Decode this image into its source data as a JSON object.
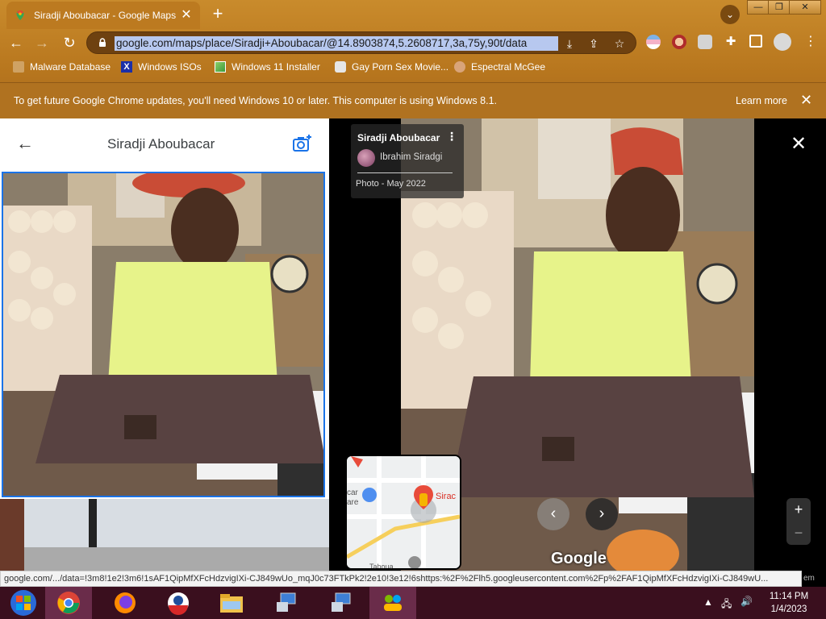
{
  "browser": {
    "tab_title": "Siradji Aboubacar - Google Maps",
    "url": "google.com/maps/place/Siradji+Aboubacar/@14.8903874,5.2608717,3a,75y,90t/data",
    "bookmarks": [
      {
        "label": "Malware Database"
      },
      {
        "label": "Windows ISOs"
      },
      {
        "label": "Windows 11 Installer"
      },
      {
        "label": "Gay Porn Sex Movie..."
      },
      {
        "label": "Espectral McGee"
      }
    ],
    "infobar": {
      "message": "To get future Google Chrome updates, you'll need Windows 10 or later. This computer is using Windows 8.1.",
      "link": "Learn more"
    }
  },
  "left_panel": {
    "title": "Siradji Aboubacar"
  },
  "viewer": {
    "place_name": "Siradji Aboubacar",
    "author": "Ibrahim Siradgi",
    "date": "Photo - May 2022",
    "google_logo": "Google",
    "minimap": {
      "label_right": "Sirac",
      "label_left_1": "car",
      "label_left_2": "are",
      "label_bottom": "Tahoua"
    },
    "zoom_in": "+",
    "zoom_out": "−"
  },
  "status_bar": {
    "text": "google.com/.../data=!3m8!1e2!3m6!1sAF1QipMfXFcHdzvigIXi-CJ849wUo_mqJ0c73FTkPk2!2e10!3e12!6shttps:%2F%2Flh5.googleusercontent.com%2Fp%2FAF1QipMfXFcHdzvigIXi-CJ849wU...",
    "edge_text": "em"
  },
  "taskbar": {
    "time": "11:14 PM",
    "date": "1/4/2023"
  },
  "colors": {
    "chrome_bg": "#bc7a20",
    "accent_blue": "#1a73e8",
    "taskbar": "#3a0f1e"
  }
}
